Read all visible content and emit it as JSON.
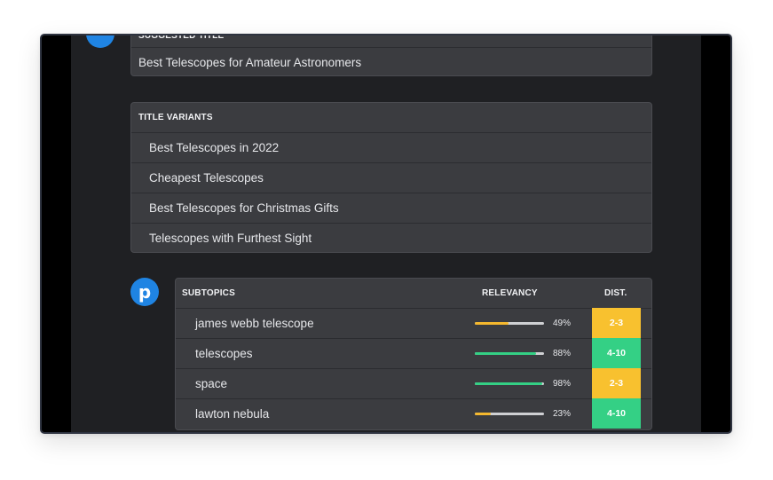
{
  "suggested_title": {
    "header": "SUGGESTED TITLE",
    "value": "Best Telescopes for Amateur Astronomers"
  },
  "title_variants": {
    "header": "TITLE VARIANTS",
    "items": [
      "Best Telescopes in 2022",
      "Cheapest Telescopes",
      "Best Telescopes for Christmas Gifts",
      "Telescopes with Furthest Sight"
    ]
  },
  "avatar": {
    "letter": "p",
    "color": "#1f84e3"
  },
  "subtopics": {
    "headers": {
      "topic": "SUBTOPICS",
      "relevancy": "RELEVANCY",
      "distance": "DIST."
    },
    "rows": [
      {
        "topic": "james webb telescope",
        "relevancy": 49,
        "relevancy_label": "49%",
        "distance": "2-3",
        "bar_color": "#f5b82e",
        "dist_color": "#f8c12f"
      },
      {
        "topic": "telescopes",
        "relevancy": 88,
        "relevancy_label": "88%",
        "distance": "4-10",
        "bar_color": "#34d085",
        "dist_color": "#34d085"
      },
      {
        "topic": "space",
        "relevancy": 98,
        "relevancy_label": "98%",
        "distance": "2-3",
        "bar_color": "#34d085",
        "dist_color": "#f8c12f"
      },
      {
        "topic": "lawton nebula",
        "relevancy": 23,
        "relevancy_label": "23%",
        "distance": "4-10",
        "bar_color": "#f5b82e",
        "dist_color": "#34d085"
      }
    ]
  }
}
